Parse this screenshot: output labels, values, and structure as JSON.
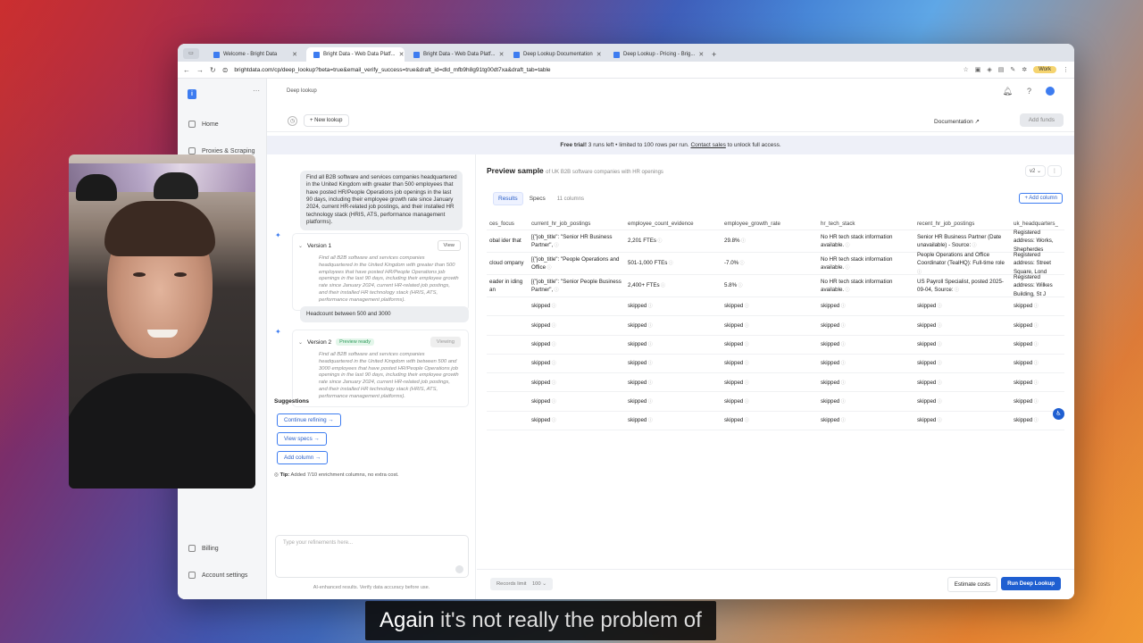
{
  "browser": {
    "tabs": [
      {
        "label": "Welcome - Bright Data",
        "active": false
      },
      {
        "label": "Bright Data - Web Data Platf...",
        "active": true
      },
      {
        "label": "Bright Data - Web Data Platf...",
        "active": false
      },
      {
        "label": "Deep Lookup Documentation",
        "active": false
      },
      {
        "label": "Deep Lookup - Pricing - Brig...",
        "active": false
      }
    ],
    "new_tab": "+",
    "url": "brightdata.com/cp/deep_lookup?beta=true&email_verify_success=true&draft_id=dld_mfb9h8g91tg00dt7xa&draft_tab=table",
    "profile_label": "Work"
  },
  "sidebar": {
    "items": [
      {
        "label": "Home",
        "icon": "home-icon"
      },
      {
        "label": "Proxies & Scraping",
        "icon": "globe-icon"
      },
      {
        "label": "Billing",
        "icon": "billing-icon"
      },
      {
        "label": "Account settings",
        "icon": "settings-icon"
      }
    ]
  },
  "header": {
    "breadcrumb": "Deep lookup",
    "new_lookup": "+ New lookup",
    "documentation": "Documentation ↗",
    "add_funds": "Add funds"
  },
  "banner": {
    "bold": "Free trial!",
    "text": " 3 runs left • limited to 100 rows per run. ",
    "link": "Contact sales",
    "suffix": " to unlock full access."
  },
  "chat": {
    "prompt": "Find all B2B software and services companies headquartered in the United Kingdom with greater than 500 employees that have posted HR/People Operations job openings in the last 90 days, including their employee growth rate since January 2024, current HR-related job postings, and their installed HR technology stack (HRIS, ATS, performance management platforms).",
    "version1": {
      "title": "Version 1",
      "button": "View",
      "text": "Find all B2B software and services companies headquartered in the United Kingdom with greater than 500 employees that have posted HR/People Operations job openings in the last 90 days, including their employee growth rate since January 2024, current HR-related job postings, and their installed HR technology stack (HRIS, ATS, performance management platforms)."
    },
    "refinement": "Headcount between 500 and 3000",
    "version2": {
      "title": "Version 2",
      "badge": "Preview ready",
      "button": "Viewing",
      "text": "Find all B2B software and services companies headquartered in the United Kingdom with between 500 and 3000 employees that have posted HR/People Operations job openings in the last 90 days, including their employee growth rate since January 2024, current HR-related job postings, and their installed HR technology stack (HRIS, ATS, performance management platforms)."
    },
    "suggestions_title": "Suggestions",
    "suggestions": [
      "Continue refining →",
      "View specs →",
      "Add column →"
    ],
    "tip_label": "Tip:",
    "tip_text": " Added 7/10 enrichment columns, no extra cost.",
    "refine_placeholder": "Type your refinements here...",
    "disclaimer": "AI-enhanced results. Verify data accuracy before use."
  },
  "preview": {
    "title": "Preview sample",
    "subtitle": "of UK B2B software companies with HR openings",
    "version_select": "v2",
    "tabs": [
      "Results",
      "Specs"
    ],
    "columns_count": "11 columns",
    "add_column": "+ Add column",
    "headers": [
      "ces_focus",
      "current_hr_job_postings",
      "employee_count_evidence",
      "employee_growth_rate",
      "hr_tech_stack",
      "recent_hr_job_postings",
      "uk_headquarters_"
    ],
    "rows": [
      [
        "obal ider that",
        "[{\"job_title\": \"Senior HR Business Partner\",",
        "2,201 FTEs",
        "29.8%",
        "No HR tech stack information available.",
        "Senior HR Business Partner (Date unavailable) - Source:",
        "Registered address: Works, Shepherdes"
      ],
      [
        "cloud ompany",
        "[{\"job_title\": \"People Operations and Office",
        "501-1,000 FTEs",
        "-7.0%",
        "No HR tech stack information available.",
        "People Operations and Office Coordinator (TealHQ): Full-time role",
        "Registered address: Street Square, Lond"
      ],
      [
        "eader in iding an",
        "[{\"job_title\": \"Senior People Business Partner\",",
        "2,400+ FTEs",
        "5.8%",
        "No HR tech stack information available.",
        "US Payroll Specialist, posted 2025-09-04, Source:",
        "Registered address: Wilkes Building, St J"
      ]
    ],
    "skipped_label": "skipped",
    "skipped_rows": 7,
    "records_limit": "Records limit",
    "records_value": "100",
    "estimate": "Estimate costs",
    "run": "Run Deep Lookup"
  },
  "caption": {
    "highlight": "Again",
    "rest": " it's not really the problem of"
  }
}
